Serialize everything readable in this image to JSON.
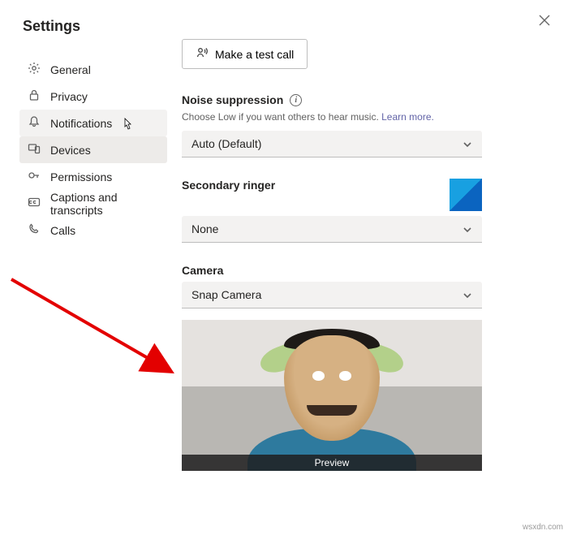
{
  "title": "Settings",
  "sidebar": {
    "items": [
      {
        "label": "General"
      },
      {
        "label": "Privacy"
      },
      {
        "label": "Notifications"
      },
      {
        "label": "Devices"
      },
      {
        "label": "Permissions"
      },
      {
        "label": "Captions and transcripts"
      },
      {
        "label": "Calls"
      }
    ]
  },
  "main": {
    "test_call_label": "Make a test call",
    "noise": {
      "heading": "Noise suppression",
      "hint_pre": "Choose Low if you want others to hear music. ",
      "hint_link": "Learn more.",
      "value": "Auto (Default)"
    },
    "ringer": {
      "heading": "Secondary ringer",
      "value": "None"
    },
    "camera": {
      "heading": "Camera",
      "value": "Snap Camera",
      "preview_label": "Preview"
    }
  },
  "watermark": "wsxdn.com"
}
